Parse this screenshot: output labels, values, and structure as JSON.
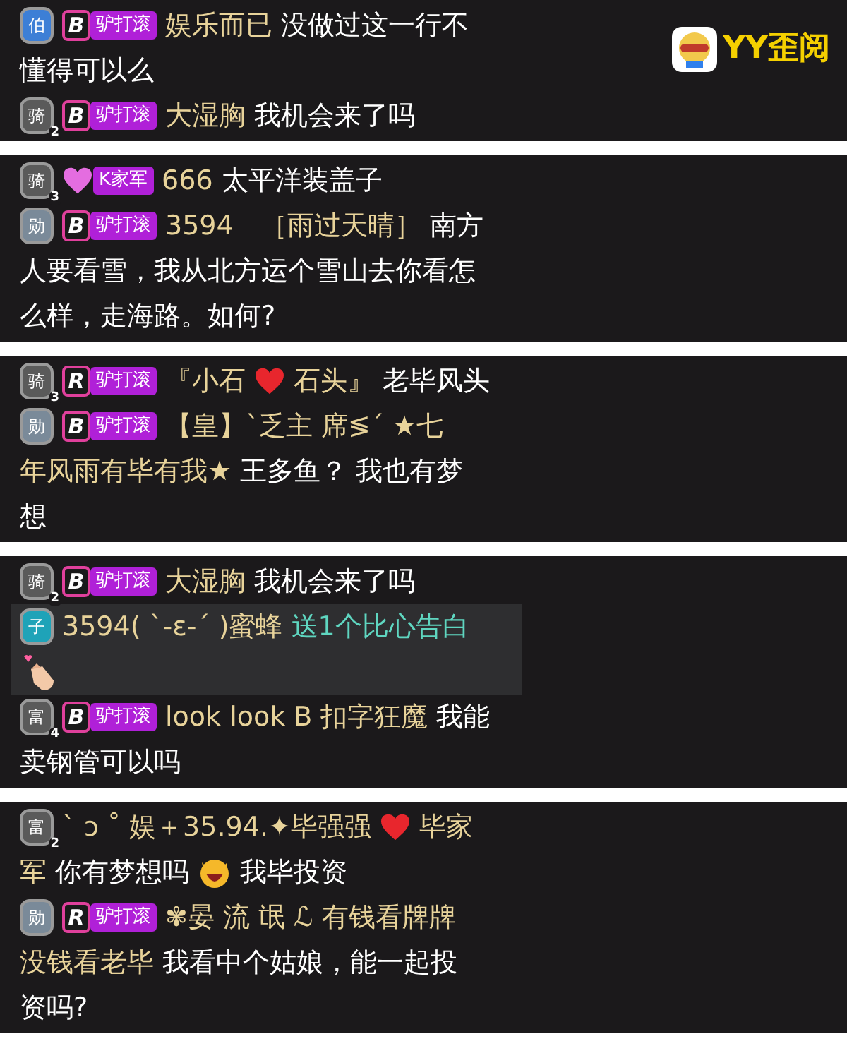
{
  "watermark_logo": {
    "text": "YY歪阅"
  },
  "panels": [
    {
      "messages": [
        {
          "kind": "chat",
          "level": {
            "char": "伯",
            "color": "#3d7fd6"
          },
          "fan": {
            "kind": "rank",
            "logo": "B",
            "label": "驴打滚"
          },
          "lines": [
            [
              {
                "kind": "name",
                "text": "娱乐而已"
              },
              {
                "kind": "content",
                "text": "没做过这一行不"
              }
            ],
            [
              {
                "kind": "content",
                "text": "懂得可以么"
              }
            ]
          ]
        },
        {
          "kind": "chat",
          "level": {
            "char": "骑",
            "num": "2",
            "color": "#5a5a5a"
          },
          "fan": {
            "kind": "rank",
            "logo": "B",
            "label": "驴打滚"
          },
          "lines": [
            [
              {
                "kind": "name",
                "text": "大湿胸"
              },
              {
                "kind": "content",
                "text": "我机会来了吗"
              }
            ]
          ]
        }
      ]
    },
    {
      "messages": [
        {
          "kind": "chat",
          "level": {
            "char": "骑",
            "num": "3",
            "color": "#5a5a5a"
          },
          "fan": {
            "kind": "heart",
            "label": "K家军"
          },
          "lines": [
            [
              {
                "kind": "name",
                "text": "666"
              },
              {
                "kind": "content",
                "text": "太平洋装盖子"
              }
            ]
          ]
        },
        {
          "kind": "chat",
          "level": {
            "char": "勋",
            "color": "#7a8a99"
          },
          "fan": {
            "kind": "rank",
            "logo": "B",
            "label": "驴打滚"
          },
          "lines": [
            [
              {
                "kind": "name",
                "text": "3594　［雨过天晴］"
              },
              {
                "kind": "content",
                "text": "南方"
              }
            ],
            [
              {
                "kind": "content",
                "text": "人要看雪，我从北方运个雪山去你看怎"
              }
            ],
            [
              {
                "kind": "content",
                "text": "么样，走海路。如何?"
              }
            ]
          ]
        }
      ]
    },
    {
      "messages": [
        {
          "kind": "chat",
          "level": {
            "char": "骑",
            "num": "3",
            "color": "#5a5a5a"
          },
          "fan": {
            "kind": "rank",
            "logo": "R",
            "label": "驴打滚"
          },
          "lines": [
            [
              {
                "kind": "name",
                "text": "『小石"
              },
              {
                "kind": "heart"
              },
              {
                "kind": "name",
                "text": "石头』"
              },
              {
                "kind": "content",
                "text": "老毕风头"
              }
            ]
          ]
        },
        {
          "kind": "chat",
          "level": {
            "char": "勋",
            "color": "#7a8a99"
          },
          "fan": {
            "kind": "rank",
            "logo": "B",
            "label": "驴打滚"
          },
          "lines": [
            [
              {
                "kind": "name",
                "text": "【皇】ˋ乏主 席≶ˊ ★七"
              }
            ],
            [
              {
                "kind": "name",
                "text": "年风雨有毕有我★"
              },
              {
                "kind": "content",
                "text": "王多鱼？ 我也有梦"
              }
            ],
            [
              {
                "kind": "content",
                "text": "想"
              }
            ]
          ]
        }
      ]
    },
    {
      "messages": [
        {
          "kind": "chat",
          "level": {
            "char": "骑",
            "num": "2",
            "color": "#5a5a5a"
          },
          "fan": {
            "kind": "rank",
            "logo": "B",
            "label": "驴打滚"
          },
          "lines": [
            [
              {
                "kind": "name",
                "text": "大湿胸"
              },
              {
                "kind": "content",
                "text": "我机会来了吗"
              }
            ]
          ]
        },
        {
          "kind": "gift",
          "level": {
            "char": "子",
            "color": "#1fa3b8"
          },
          "lines": [
            [
              {
                "kind": "name",
                "text": "3594( ˋ-ε-ˊ )蜜蜂"
              },
              {
                "kind": "gift",
                "text": "送1个比心告白"
              }
            ],
            [
              {
                "kind": "gift-icon"
              }
            ]
          ]
        },
        {
          "kind": "chat",
          "level": {
            "char": "富",
            "num": "4",
            "color": "#5a5a5a"
          },
          "fan": {
            "kind": "rank",
            "logo": "B",
            "label": "驴打滚"
          },
          "lines": [
            [
              {
                "kind": "name",
                "text": "look look B 扣字狂魔"
              },
              {
                "kind": "content",
                "text": "我能"
              }
            ],
            [
              {
                "kind": "content",
                "text": "卖钢管可以吗"
              }
            ]
          ]
        }
      ]
    },
    {
      "messages": [
        {
          "kind": "chat",
          "level": {
            "char": "富",
            "num": "2",
            "color": "#5a5a5a"
          },
          "lines": [
            [
              {
                "kind": "name",
                "text": "ˋ ɔ ˚ 娱＋35.94.✦毕强强"
              },
              {
                "kind": "heart"
              },
              {
                "kind": "name",
                "text": "毕家"
              }
            ],
            [
              {
                "kind": "name",
                "text": "军"
              },
              {
                "kind": "content",
                "text": "你有梦想吗"
              },
              {
                "kind": "emoji"
              },
              {
                "kind": "content",
                "text": "我毕投资"
              }
            ]
          ]
        },
        {
          "kind": "chat",
          "level": {
            "char": "勋",
            "color": "#7a8a99"
          },
          "fan": {
            "kind": "rank",
            "logo": "R",
            "label": "驴打滚"
          },
          "lines": [
            [
              {
                "kind": "name",
                "text": "✾晏 流 氓 ℒ 有钱看牌牌"
              }
            ],
            [
              {
                "kind": "name",
                "text": "没钱看老毕"
              },
              {
                "kind": "content",
                "text": "我看中个姑娘，能一起投"
              }
            ],
            [
              {
                "kind": "content",
                "text": "资吗?"
              }
            ]
          ]
        }
      ]
    }
  ]
}
